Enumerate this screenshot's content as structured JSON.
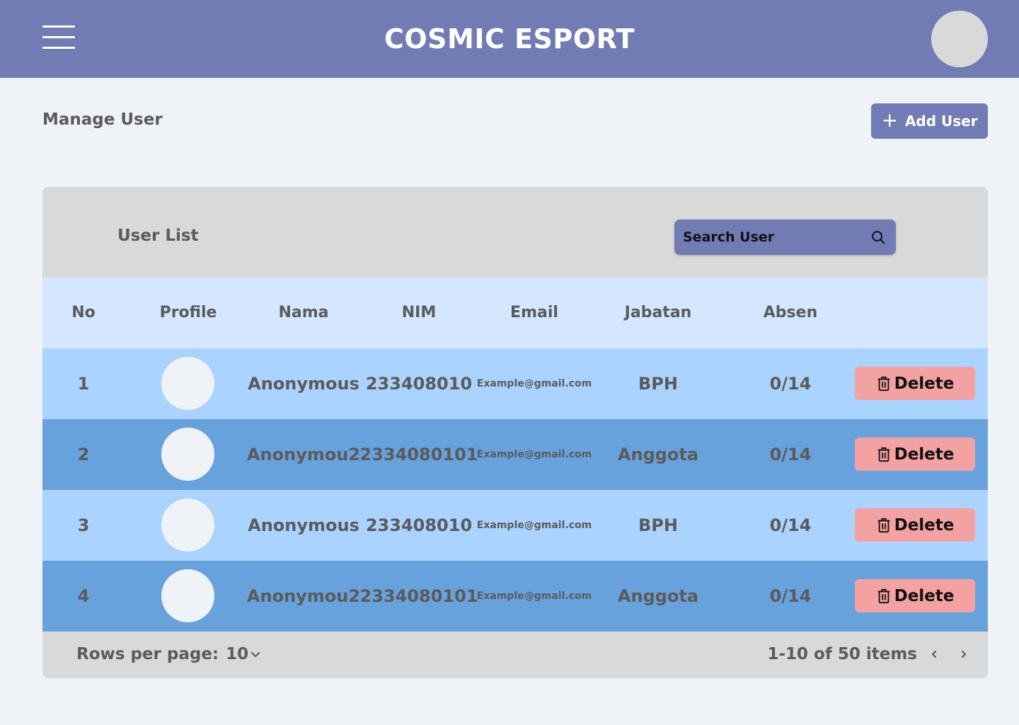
{
  "header": {
    "app_title": "COSMIC ESPORT",
    "menu_icon": "hamburger-menu-icon",
    "avatar_icon": "user-avatar"
  },
  "page": {
    "title": "Manage User",
    "add_user_label": "Add User",
    "add_user_icon": "plus-icon"
  },
  "user_list": {
    "title": "User List",
    "search": {
      "placeholder": "Search User",
      "value": "",
      "icon": "search-icon"
    },
    "columns": [
      "No",
      "Profile",
      "Nama",
      "NIM",
      "Email",
      "Jabatan",
      "Absen"
    ],
    "rows": [
      {
        "no": "1",
        "nama": "Anonymous",
        "nim": "233408010",
        "email": "Example@gmail.com",
        "jabatan": "BPH",
        "absen": "0/14",
        "delete_label": "Delete"
      },
      {
        "no": "2",
        "nama": "Anonymou2",
        "nim": "2334080101",
        "email": "Example@gmail.com",
        "jabatan": "Anggota",
        "absen": "0/14",
        "delete_label": "Delete"
      },
      {
        "no": "3",
        "nama": "Anonymous",
        "nim": "233408010",
        "email": "Example@gmail.com",
        "jabatan": "BPH",
        "absen": "0/14",
        "delete_label": "Delete"
      },
      {
        "no": "4",
        "nama": "Anonymou2",
        "nim": "2334080101",
        "email": "Example@gmail.com",
        "jabatan": "Anggota",
        "absen": "0/14",
        "delete_label": "Delete"
      }
    ]
  },
  "footer": {
    "rows_per_page_label": "Rows per page:",
    "rows_per_page_value": "10",
    "pagination_info": "1-10 of 50 items"
  },
  "colors": {
    "header_bg": "#717cb4",
    "page_bg": "#eff3f8",
    "card_bg": "#d9d9d9",
    "table_head_bg": "#d4e7ff",
    "row_light_bg": "#aad3ff",
    "row_dark_bg": "#67a2dc",
    "delete_bg": "#f4a1a1",
    "text": "#5b5b5b"
  }
}
